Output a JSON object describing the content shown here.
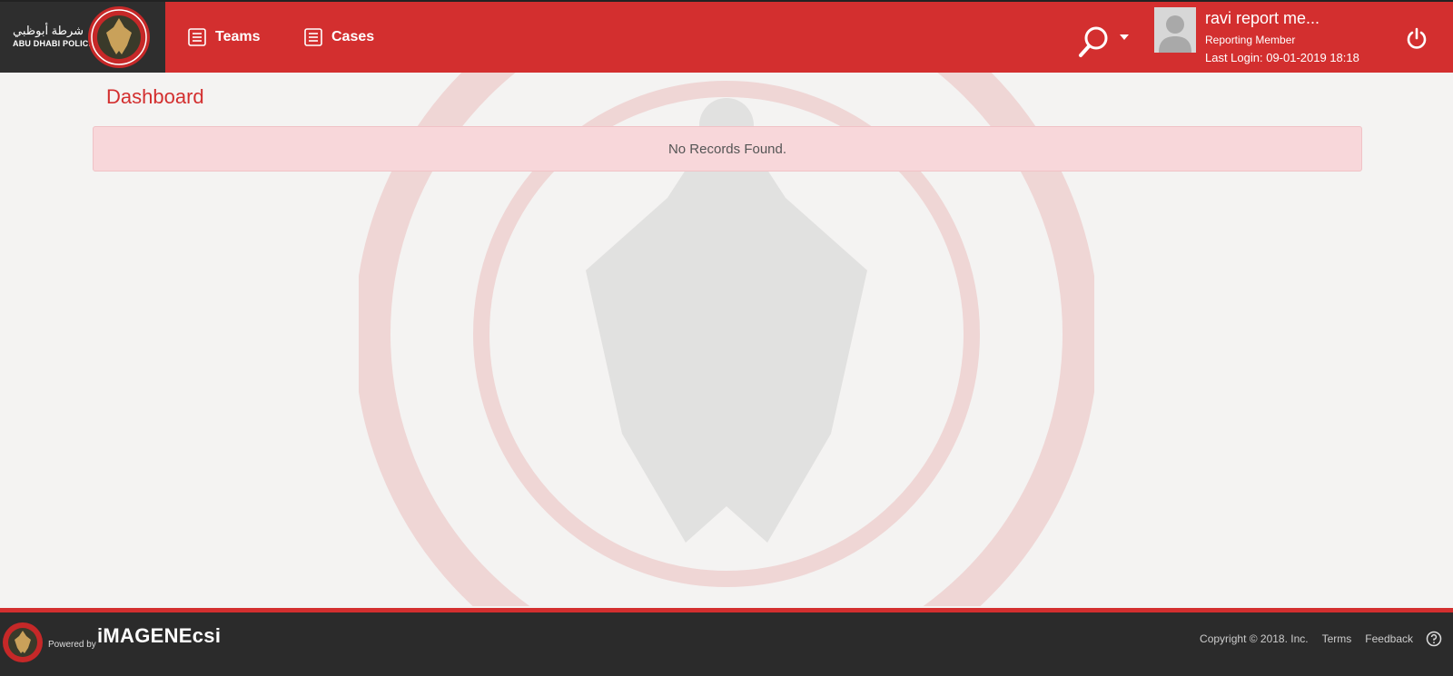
{
  "brand": {
    "arabic_name": "شرطة أبوظبي",
    "english_name": "ABU DHABI POLICE",
    "emblem_icon": "falcon-emblem-icon"
  },
  "nav": {
    "items": [
      {
        "label": "Teams",
        "icon": "list-icon"
      },
      {
        "label": "Cases",
        "icon": "list-icon"
      }
    ]
  },
  "user": {
    "name": "ravi report me...",
    "role": "Reporting Member",
    "last_login": "Last Login: 09-01-2019 18:18"
  },
  "main": {
    "title": "Dashboard",
    "alert": "No Records Found."
  },
  "footer": {
    "powered_by": "Powered by",
    "brand": "iMAGENEcsi",
    "copyright": "Copyright © 2018. Inc.",
    "terms": "Terms",
    "feedback": "Feedback"
  },
  "colors": {
    "primary": "#d32f2f",
    "dark": "#2e2e2e",
    "alert_bg": "#f8d7da"
  }
}
